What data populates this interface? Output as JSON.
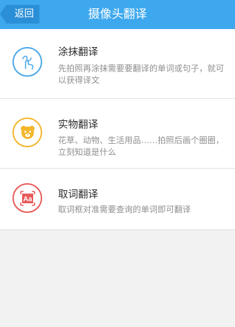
{
  "header": {
    "back_label": "返回",
    "title": "摄像头翻译",
    "color": "#3da8ee"
  },
  "items": [
    {
      "title": "涂抹翻译",
      "desc": "先拍照再涂抹需要要翻译的单词或句子，就可以获得译文",
      "icon": "finger-smear-icon",
      "color": "#4aa8e8"
    },
    {
      "title": "实物翻译",
      "desc": "花草、动物、生活用品……拍照后画个圈圈，立刻知道是什么",
      "icon": "bear-icon",
      "color": "#f3b62c"
    },
    {
      "title": "取词翻译",
      "desc": "取词框对准需要查询的单词即可翻译",
      "icon": "text-aa-icon",
      "color": "#e85a5a"
    }
  ]
}
